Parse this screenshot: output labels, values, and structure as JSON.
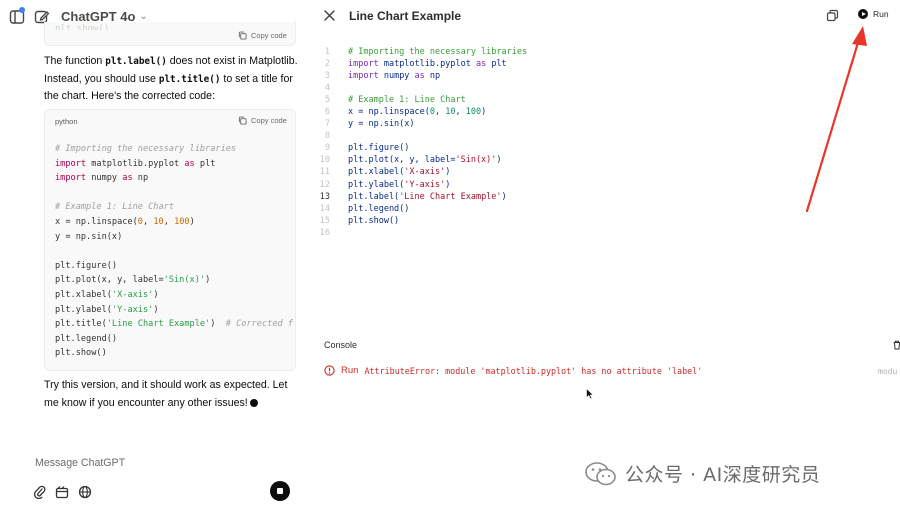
{
  "sidebar": {
    "model_name": "ChatGPT 4o"
  },
  "chat": {
    "top_card": {
      "copy_label": "Copy code"
    },
    "message_part1": "The function ",
    "message_code1": "plt.label()",
    "message_part2": " does not exist in Matplotlib. Instead, you should use ",
    "message_code2": "plt.title()",
    "message_part3": " to set a title for the chart. Here's the corrected code:",
    "code_card": {
      "language": "python",
      "copy_label": "Copy code",
      "lines": [
        {
          "t": "# Importing the necessary libraries",
          "c": "cm"
        },
        {
          "t": "import",
          "c": "kw",
          "rest": " matplotlib.pyplot ",
          "kw2": "as",
          "rest2": " plt"
        },
        {
          "t": "import",
          "c": "kw",
          "rest": " numpy ",
          "kw2": "as",
          "rest2": " np"
        },
        {
          "t": "",
          "c": ""
        },
        {
          "t": "# Example 1: Line Chart",
          "c": "cm"
        },
        {
          "t": "x = np.linspace(0, 10, 100)",
          "c": "code"
        },
        {
          "t": "y = np.sin(x)",
          "c": "code"
        },
        {
          "t": "",
          "c": ""
        },
        {
          "t": "plt.figure()",
          "c": "code"
        },
        {
          "t": "plt.plot(x, y, label='Sin(x)')",
          "c": "code"
        },
        {
          "t": "plt.xlabel('X-axis')",
          "c": "code"
        },
        {
          "t": "plt.ylabel('Y-axis')",
          "c": "code"
        },
        {
          "t": "plt.title('Line Chart Example')  # Corrected f",
          "c": "code"
        },
        {
          "t": "plt.legend()",
          "c": "code"
        },
        {
          "t": "plt.show()",
          "c": "code"
        }
      ]
    },
    "closing_message": "Try this version, and it should work as expected. Let me know if you encounter any other issues!",
    "composer_placeholder": "Message ChatGPT"
  },
  "canvas": {
    "title": "Line Chart Example",
    "run_label": "Run",
    "active_line": 13,
    "editor_lines": [
      "# Importing the necessary libraries",
      "import matplotlib.pyplot as plt",
      "import numpy as np",
      "",
      "# Example 1: Line Chart",
      "x = np.linspace(0, 10, 100)",
      "y = np.sin(x)",
      "",
      "plt.figure()",
      "plt.plot(x, y, label='Sin(x)')",
      "plt.xlabel('X-axis')",
      "plt.ylabel('Y-axis')",
      "plt.label('Line Chart Example')",
      "plt.legend()",
      "plt.show()",
      ""
    ],
    "console": {
      "title": "Console",
      "run_label": "Run",
      "error_type": "AttributeError:",
      "error_message": " module 'matplotlib.pyplot' has no attribute 'label'",
      "error_tag": "modu"
    }
  },
  "watermark": {
    "text": "公众号 · AI深度研究员"
  },
  "colors": {
    "accent_dot": "#3b82f6",
    "error": "#c92a2a",
    "arrow": "#e8362b"
  }
}
